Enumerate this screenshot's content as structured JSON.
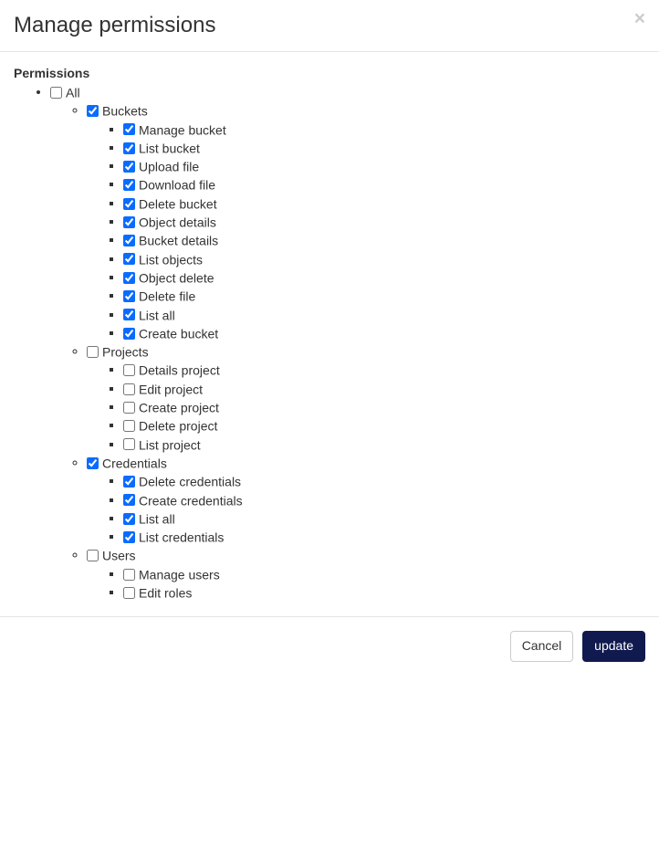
{
  "modal": {
    "title": "Manage permissions",
    "close_symbol": "×"
  },
  "heading": "Permissions",
  "tree": {
    "label": "All",
    "checked": false,
    "children": [
      {
        "label": "Buckets",
        "checked": true,
        "children": [
          {
            "label": "Manage bucket",
            "checked": true
          },
          {
            "label": "List bucket",
            "checked": true
          },
          {
            "label": "Upload file",
            "checked": true
          },
          {
            "label": "Download file",
            "checked": true
          },
          {
            "label": "Delete bucket",
            "checked": true
          },
          {
            "label": "Object details",
            "checked": true
          },
          {
            "label": "Bucket details",
            "checked": true
          },
          {
            "label": "List objects",
            "checked": true
          },
          {
            "label": "Object delete",
            "checked": true
          },
          {
            "label": "Delete file",
            "checked": true
          },
          {
            "label": "List all",
            "checked": true
          },
          {
            "label": "Create bucket",
            "checked": true
          }
        ]
      },
      {
        "label": "Projects",
        "checked": false,
        "children": [
          {
            "label": "Details project",
            "checked": false
          },
          {
            "label": "Edit project",
            "checked": false
          },
          {
            "label": "Create project",
            "checked": false
          },
          {
            "label": "Delete project",
            "checked": false
          },
          {
            "label": "List project",
            "checked": false
          }
        ]
      },
      {
        "label": "Credentials",
        "checked": true,
        "children": [
          {
            "label": "Delete credentials",
            "checked": true
          },
          {
            "label": "Create credentials",
            "checked": true
          },
          {
            "label": "List all",
            "checked": true
          },
          {
            "label": "List credentials",
            "checked": true
          }
        ]
      },
      {
        "label": "Users",
        "checked": false,
        "children": [
          {
            "label": "Manage users",
            "checked": false
          },
          {
            "label": "Edit roles",
            "checked": false
          }
        ]
      }
    ]
  },
  "footer": {
    "cancel_label": "Cancel",
    "update_label": "update"
  }
}
